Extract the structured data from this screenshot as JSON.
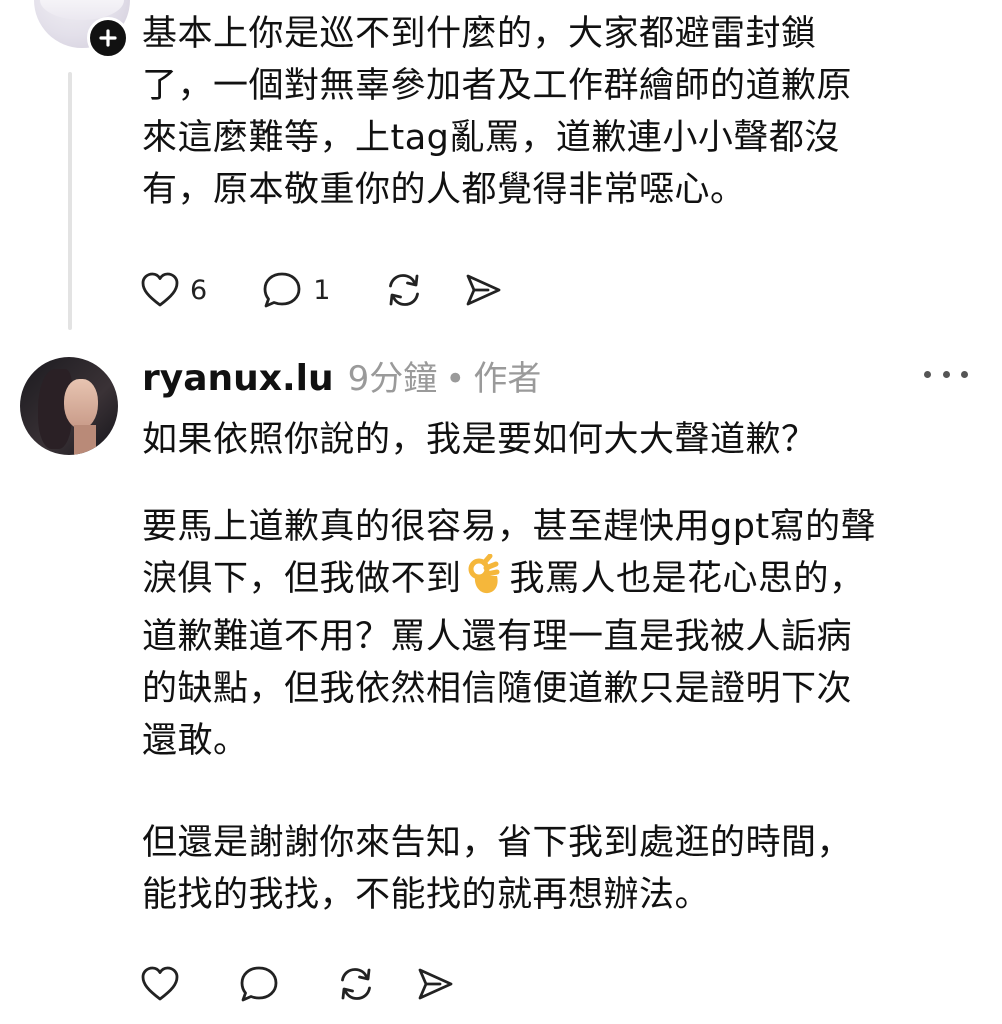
{
  "previous_comment": {
    "text_lines": [
      "基本上你是巡不到什麼的，大家都避雷封鎖",
      "了，一個對無辜參加者及工作群繪師的道歉原",
      "來這麼難等，上tag亂罵，道歉連小小聲都沒",
      "有，原本敬重你的人都覺得非常噁心。"
    ],
    "likes_count": "6",
    "replies_count": "1",
    "icons": [
      "plus-icon",
      "heart-icon",
      "comment-icon",
      "repost-icon",
      "share-icon"
    ]
  },
  "reply_comment": {
    "username": "ryanux.lu",
    "timestamp": "9分鐘",
    "separator": "•",
    "author_tag": "作者",
    "paragraph_1": [
      "如果依照你說的，我是要如何大大聲道歉？"
    ],
    "paragraph_2": {
      "line_1": "要馬上道歉真的很容易，甚至趕快用gpt寫的聲",
      "line_2_before_emoji": "淚俱下，但我做不到",
      "line_2_emoji": "ok-hand-emoji",
      "line_2_after_emoji": "我罵人也是花心思的，",
      "line_3": "道歉難道不用？罵人還有理一直是我被人詬病",
      "line_4": "的缺點，但我依然相信隨便道歉只是證明下次",
      "line_5": "還敢。"
    },
    "paragraph_3": [
      "但還是謝謝你來告知，省下我到處逛的時間，",
      "能找的我找，不能找的就再想辦法。"
    ],
    "icons": [
      "more-icon",
      "heart-icon",
      "comment-icon",
      "repost-icon",
      "share-icon"
    ]
  },
  "colors": {
    "text": "#111111",
    "muted": "#9a9a9a",
    "thread_line": "#e3e3e3",
    "background": "#ffffff"
  }
}
